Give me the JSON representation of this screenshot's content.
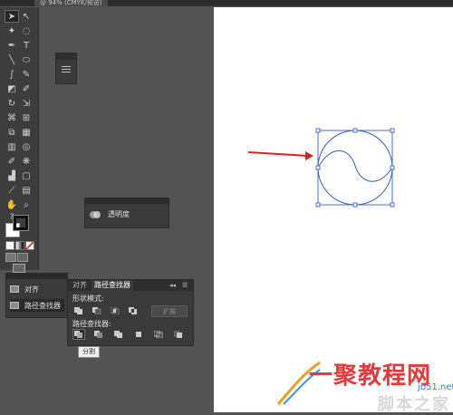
{
  "document_tab": "@ 94% (CMYK/预览)",
  "panels": {
    "transparency": {
      "label": "透明度"
    },
    "dock": {
      "items": [
        "对齐",
        "路径查找器"
      ]
    },
    "pathfinder": {
      "tabs": [
        "对齐",
        "路径查找器"
      ],
      "shape_modes_label": "形状模式:",
      "pathfinders_label": "路径查找器:",
      "expand_label": "扩展",
      "tooltip": "分割"
    }
  },
  "watermark": {
    "main": "一聚教程网",
    "url": "jb51.net",
    "sub": "脚本之家"
  },
  "colors": {
    "arrow": "#e02020",
    "circle": "#3a5fa8",
    "selection": "#4a6fd0"
  },
  "icons": [
    "selection-arrow-icon",
    "direct-selection-icon",
    "magic-wand-icon",
    "lasso-icon",
    "pen-icon",
    "type-icon",
    "line-icon",
    "ellipse-icon",
    "brush-icon",
    "pencil-icon",
    "eraser-icon",
    "rotate-icon",
    "scale-icon",
    "warp-icon",
    "free-transform-icon",
    "shape-builder-icon",
    "perspective-icon",
    "mesh-icon",
    "gradient-icon",
    "eyedropper-icon",
    "blend-icon",
    "symbol-sprayer-icon",
    "graph-icon",
    "artboard-icon",
    "slice-icon",
    "hand-icon",
    "zoom-icon"
  ]
}
